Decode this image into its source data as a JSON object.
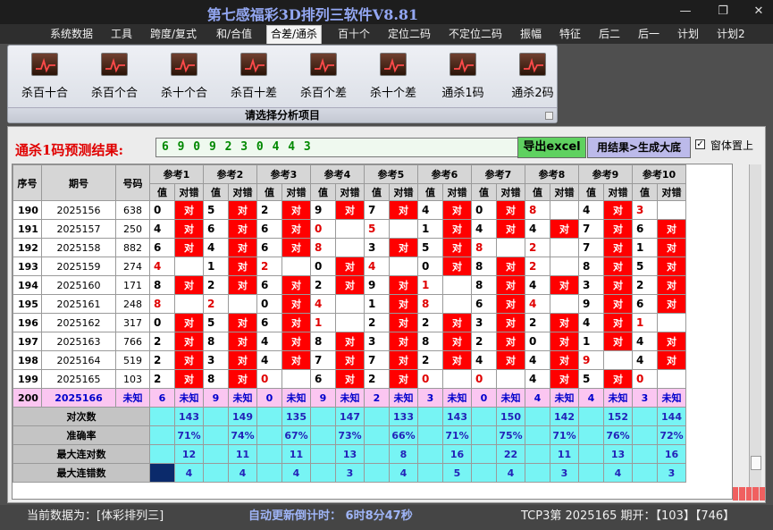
{
  "window": {
    "title": "第七感福彩3D排列三软件V8.81",
    "min_glyph": "—",
    "max_glyph": "❐",
    "close_glyph": "✕"
  },
  "menu": [
    "系统数据",
    "工具",
    "跨度/复式",
    "和/合值",
    "合差/通杀",
    "百十个",
    "定位二码",
    "不定位二码",
    "振幅",
    "特征",
    "后二",
    "后一",
    "计划",
    "计划2"
  ],
  "menu_active": "合差/通杀",
  "ribbon": {
    "buttons": [
      "杀百十合",
      "杀百个合",
      "杀十个合",
      "杀百十差",
      "杀百个差",
      "杀十个差",
      "通杀1码",
      "通杀2码"
    ],
    "footer": "请选择分析项目"
  },
  "prediction": {
    "label": "通杀1码预测结果:",
    "value": "6 9 0 9 2 3 0 4 4 3",
    "excel_button": "导出excel",
    "gen_button": "用结果>生成大底",
    "topmost_label": "窗体置上",
    "topmost_checked": true
  },
  "table": {
    "col_headers": {
      "seq": "序号",
      "period": "期号",
      "number": "号码"
    },
    "refs": [
      "参考1",
      "参考2",
      "参考3",
      "参考4",
      "参考5",
      "参考6",
      "参考7",
      "参考8",
      "参考9",
      "参考10"
    ],
    "subheaders": {
      "value": "值",
      "result": "对错"
    },
    "correct_mark": "对",
    "rows": [
      {
        "seq": "190",
        "period": "2025156",
        "num": "638",
        "vals": [
          "0",
          "5",
          "2",
          "9",
          "7",
          "4",
          "0",
          "8",
          "4",
          "3"
        ],
        "hit": [
          1,
          1,
          1,
          1,
          1,
          1,
          1,
          0,
          1,
          0
        ],
        "red": [
          0,
          0,
          0,
          0,
          0,
          0,
          0,
          1,
          0,
          1
        ]
      },
      {
        "seq": "191",
        "period": "2025157",
        "num": "250",
        "vals": [
          "4",
          "6",
          "6",
          "0",
          "5",
          "1",
          "4",
          "4",
          "7",
          "6"
        ],
        "hit": [
          1,
          1,
          1,
          0,
          0,
          1,
          1,
          1,
          1,
          1
        ],
        "red": [
          0,
          0,
          0,
          1,
          1,
          0,
          0,
          0,
          0,
          0
        ]
      },
      {
        "seq": "192",
        "period": "2025158",
        "num": "882",
        "vals": [
          "6",
          "4",
          "6",
          "8",
          "3",
          "5",
          "8",
          "2",
          "7",
          "1"
        ],
        "hit": [
          1,
          1,
          1,
          0,
          1,
          1,
          0,
          0,
          1,
          1
        ],
        "red": [
          0,
          0,
          0,
          1,
          0,
          0,
          1,
          1,
          0,
          0
        ]
      },
      {
        "seq": "193",
        "period": "2025159",
        "num": "274",
        "vals": [
          "4",
          "1",
          "2",
          "0",
          "4",
          "0",
          "8",
          "2",
          "8",
          "5"
        ],
        "hit": [
          0,
          1,
          0,
          1,
          0,
          1,
          1,
          0,
          1,
          1
        ],
        "red": [
          1,
          0,
          1,
          0,
          1,
          0,
          0,
          1,
          0,
          0
        ]
      },
      {
        "seq": "194",
        "period": "2025160",
        "num": "171",
        "vals": [
          "8",
          "2",
          "6",
          "2",
          "9",
          "1",
          "8",
          "4",
          "3",
          "2"
        ],
        "hit": [
          1,
          1,
          1,
          1,
          1,
          0,
          1,
          1,
          1,
          1
        ],
        "red": [
          0,
          0,
          0,
          0,
          0,
          1,
          0,
          0,
          0,
          0
        ]
      },
      {
        "seq": "195",
        "period": "2025161",
        "num": "248",
        "vals": [
          "8",
          "2",
          "0",
          "4",
          "1",
          "8",
          "6",
          "4",
          "9",
          "6"
        ],
        "hit": [
          0,
          0,
          1,
          0,
          1,
          0,
          1,
          0,
          1,
          1
        ],
        "red": [
          1,
          1,
          0,
          1,
          0,
          1,
          0,
          1,
          0,
          0
        ]
      },
      {
        "seq": "196",
        "period": "2025162",
        "num": "317",
        "vals": [
          "0",
          "5",
          "6",
          "1",
          "2",
          "2",
          "3",
          "2",
          "4",
          "1"
        ],
        "hit": [
          1,
          1,
          1,
          0,
          1,
          1,
          1,
          1,
          1,
          0
        ],
        "red": [
          0,
          0,
          0,
          1,
          0,
          0,
          0,
          0,
          0,
          1
        ]
      },
      {
        "seq": "197",
        "period": "2025163",
        "num": "766",
        "vals": [
          "2",
          "8",
          "4",
          "8",
          "3",
          "8",
          "2",
          "0",
          "1",
          "4"
        ],
        "hit": [
          1,
          1,
          1,
          1,
          1,
          1,
          1,
          1,
          1,
          1
        ],
        "red": [
          0,
          0,
          0,
          0,
          0,
          0,
          0,
          0,
          0,
          0
        ]
      },
      {
        "seq": "198",
        "period": "2025164",
        "num": "519",
        "vals": [
          "2",
          "3",
          "4",
          "7",
          "7",
          "2",
          "4",
          "4",
          "9",
          "4"
        ],
        "hit": [
          1,
          1,
          1,
          1,
          1,
          1,
          1,
          1,
          0,
          1
        ],
        "red": [
          0,
          0,
          0,
          0,
          0,
          0,
          0,
          0,
          1,
          0
        ]
      },
      {
        "seq": "199",
        "period": "2025165",
        "num": "103",
        "vals": [
          "2",
          "8",
          "0",
          "6",
          "2",
          "0",
          "0",
          "4",
          "5",
          "0"
        ],
        "hit": [
          1,
          1,
          0,
          1,
          1,
          0,
          0,
          1,
          1,
          0
        ],
        "red": [
          0,
          0,
          1,
          0,
          0,
          1,
          1,
          0,
          0,
          1
        ]
      }
    ],
    "unknown_row": {
      "seq": "200",
      "period": "2025166",
      "num": "未知",
      "vals": [
        "6",
        "9",
        "0",
        "9",
        "2",
        "3",
        "0",
        "4",
        "4",
        "3"
      ],
      "mark": "未知"
    },
    "stats": [
      {
        "label": "对次数",
        "vals": [
          "143",
          "149",
          "135",
          "147",
          "133",
          "143",
          "150",
          "142",
          "152",
          "144"
        ]
      },
      {
        "label": "准确率",
        "vals": [
          "71%",
          "74%",
          "67%",
          "73%",
          "66%",
          "71%",
          "75%",
          "71%",
          "76%",
          "72%"
        ]
      },
      {
        "label": "最大连对数",
        "vals": [
          "12",
          "11",
          "11",
          "13",
          "8",
          "16",
          "22",
          "11",
          "13",
          "16"
        ]
      },
      {
        "label": "最大连错数",
        "vals": [
          "4",
          "4",
          "4",
          "3",
          "4",
          "5",
          "4",
          "3",
          "4",
          "3"
        ]
      }
    ]
  },
  "status": {
    "source": "当前数据为：[体彩排列三]",
    "countdown": "自动更新倒计时：  6时8分47秒",
    "latest": "TCP3第  2025165 期开：【103】【746】"
  },
  "colors": {
    "hit": "#ff0000",
    "unknown_row": "#fbc6f1",
    "stats_row": "#77f4f4",
    "prediction_text": "#008800"
  }
}
